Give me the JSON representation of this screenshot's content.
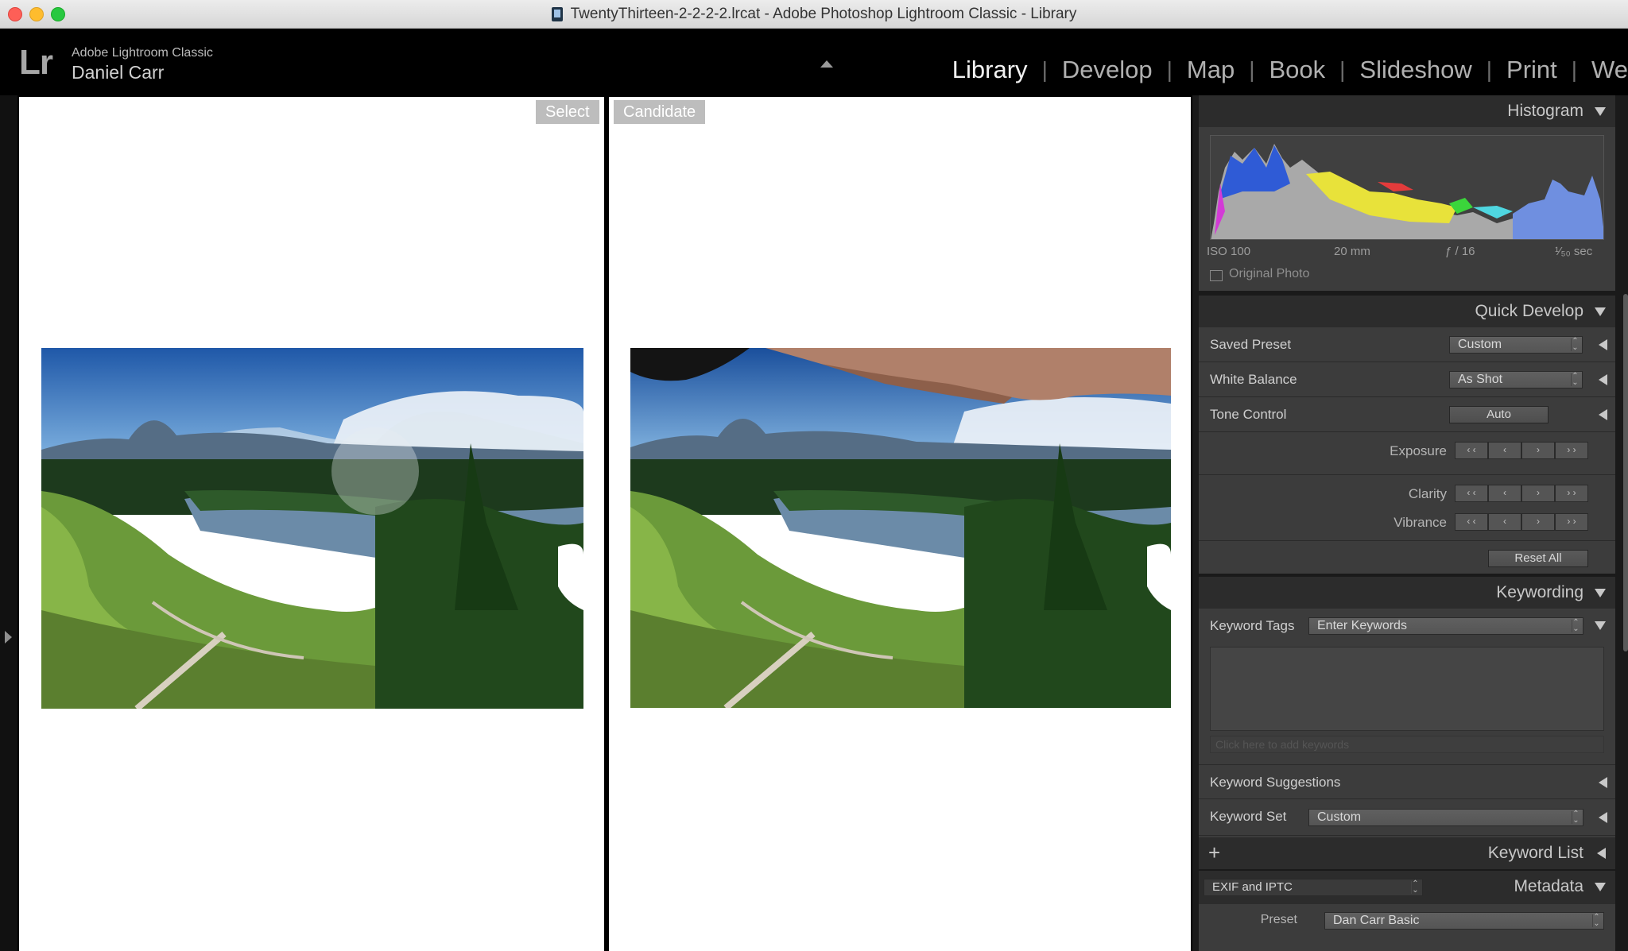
{
  "window": {
    "title": "TwentyThirteen-2-2-2-2.lrcat - Adobe Photoshop Lightroom Classic - Library"
  },
  "identity": {
    "logo": "Lr",
    "app": "Adobe Lightroom Classic",
    "user": "Daniel Carr"
  },
  "modules": [
    "Library",
    "Develop",
    "Map",
    "Book",
    "Slideshow",
    "Print",
    "We"
  ],
  "separator": "|",
  "compare": {
    "select_label": "Select",
    "candidate_label": "Candidate"
  },
  "histogram": {
    "title": "Histogram",
    "iso": "ISO 100",
    "focal": "20 mm",
    "aperture": "ƒ / 16",
    "shutter": "¹⁄₅₀ sec",
    "original_photo": "Original Photo",
    "colors": {
      "blue": "#2f5bd6",
      "yellow": "#e8e23a",
      "red": "#e33b3b",
      "green": "#3bd63b",
      "magenta": "#d33bd6",
      "cyan": "#4fd6e0",
      "gray": "#a9a9a9"
    }
  },
  "quick_develop": {
    "title": "Quick Develop",
    "saved_preset": {
      "label": "Saved Preset",
      "value": "Custom"
    },
    "white_balance": {
      "label": "White Balance",
      "value": "As Shot"
    },
    "tone_control": {
      "label": "Tone Control",
      "button": "Auto"
    },
    "exposure": "Exposure",
    "clarity": "Clarity",
    "vibrance": "Vibrance",
    "adj_buttons": [
      "‹ ‹",
      "‹",
      "›",
      "› ›"
    ],
    "reset": "Reset All"
  },
  "keywording": {
    "title": "Keywording",
    "tags_label": "Keyword Tags",
    "tags_value": "Enter Keywords",
    "hint": "Click here to add keywords",
    "suggestions": "Keyword Suggestions",
    "set_label": "Keyword Set",
    "set_value": "Custom"
  },
  "keyword_list": {
    "title": "Keyword List",
    "add": "+"
  },
  "metadata": {
    "title": "Metadata",
    "mode": "EXIF and IPTC",
    "preset_label": "Preset",
    "preset_value": "Dan Carr Basic"
  }
}
